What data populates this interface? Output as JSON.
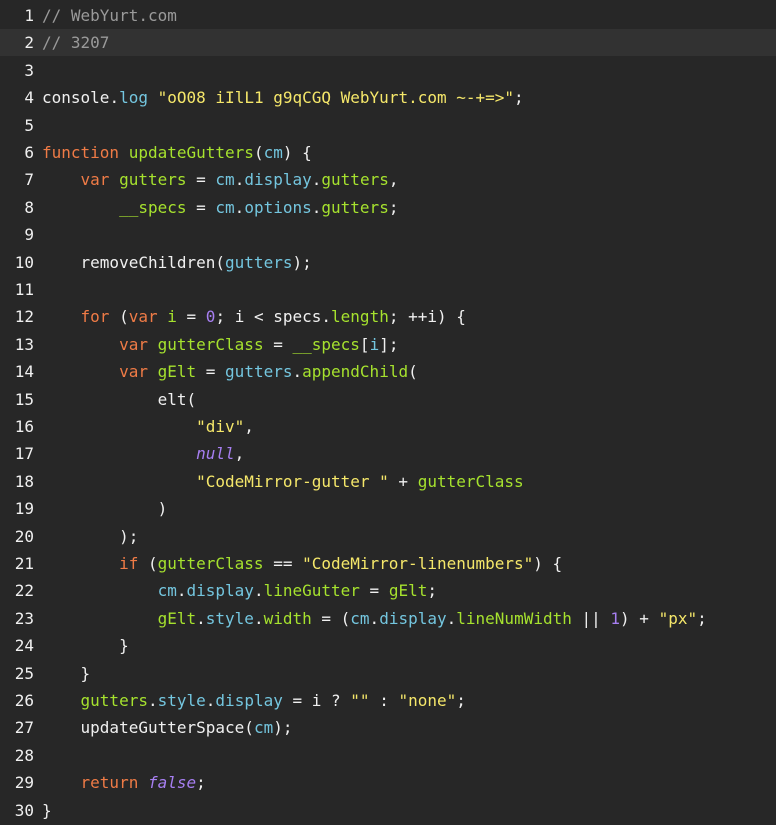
{
  "editor": {
    "active_line": 2,
    "colors": {
      "background": "#272727",
      "active_line": "#323232",
      "plain": "#f0f0f0",
      "comment": "#9a9a9a",
      "keyword": "#ef7b46",
      "atom": "#a77ff2",
      "number": "#a77ff2",
      "string": "#f5e76a",
      "variable": "#a6e22e",
      "property": "#74c6df",
      "def": "#f0f0f0",
      "operator": "#f0f0f0",
      "bracket": "#f0f0f0"
    },
    "lines": [
      {
        "n": "1",
        "indent": "",
        "tokens": [
          {
            "t": "// WebYurt.com",
            "c": "comment"
          }
        ]
      },
      {
        "n": "2",
        "indent": "",
        "tokens": [
          {
            "t": "// 3207",
            "c": "comment"
          }
        ]
      },
      {
        "n": "3",
        "indent": "",
        "tokens": []
      },
      {
        "n": "4",
        "indent": "",
        "tokens": [
          {
            "t": "console",
            "c": "plain"
          },
          {
            "t": ".",
            "c": "plain"
          },
          {
            "t": "log",
            "c": "property"
          },
          {
            "t": " ",
            "c": "plain"
          },
          {
            "t": "\"oO08 iIlL1 g9qCGQ WebYurt.com ~-+=>\"",
            "c": "string"
          },
          {
            "t": ";",
            "c": "plain"
          }
        ]
      },
      {
        "n": "5",
        "indent": "",
        "tokens": []
      },
      {
        "n": "6",
        "indent": "",
        "tokens": [
          {
            "t": "function",
            "c": "keyword"
          },
          {
            "t": " ",
            "c": "plain"
          },
          {
            "t": "updateGutters",
            "c": "variable"
          },
          {
            "t": "(",
            "c": "plain"
          },
          {
            "t": "cm",
            "c": "property"
          },
          {
            "t": ") {",
            "c": "plain"
          }
        ]
      },
      {
        "n": "7",
        "indent": "    ",
        "tokens": [
          {
            "t": "var",
            "c": "keyword"
          },
          {
            "t": " ",
            "c": "plain"
          },
          {
            "t": "gutters",
            "c": "variable"
          },
          {
            "t": " = ",
            "c": "plain"
          },
          {
            "t": "cm",
            "c": "property"
          },
          {
            "t": ".",
            "c": "plain"
          },
          {
            "t": "display",
            "c": "property"
          },
          {
            "t": ".",
            "c": "plain"
          },
          {
            "t": "gutters",
            "c": "variable"
          },
          {
            "t": ",",
            "c": "plain"
          }
        ]
      },
      {
        "n": "8",
        "indent": "        ",
        "tokens": [
          {
            "t": "__specs",
            "c": "variable"
          },
          {
            "t": " = ",
            "c": "plain"
          },
          {
            "t": "cm",
            "c": "property"
          },
          {
            "t": ".",
            "c": "plain"
          },
          {
            "t": "options",
            "c": "property"
          },
          {
            "t": ".",
            "c": "plain"
          },
          {
            "t": "gutters",
            "c": "variable"
          },
          {
            "t": ";",
            "c": "plain"
          }
        ]
      },
      {
        "n": "9",
        "indent": "",
        "tokens": []
      },
      {
        "n": "10",
        "indent": "    ",
        "tokens": [
          {
            "t": "removeChildren",
            "c": "plain"
          },
          {
            "t": "(",
            "c": "plain"
          },
          {
            "t": "gutters",
            "c": "property"
          },
          {
            "t": ");",
            "c": "plain"
          }
        ]
      },
      {
        "n": "11",
        "indent": "",
        "tokens": []
      },
      {
        "n": "12",
        "indent": "    ",
        "tokens": [
          {
            "t": "for",
            "c": "keyword"
          },
          {
            "t": " (",
            "c": "plain"
          },
          {
            "t": "var",
            "c": "keyword"
          },
          {
            "t": " ",
            "c": "plain"
          },
          {
            "t": "i",
            "c": "variable"
          },
          {
            "t": " = ",
            "c": "plain"
          },
          {
            "t": "0",
            "c": "number"
          },
          {
            "t": "; i < specs.",
            "c": "plain"
          },
          {
            "t": "length",
            "c": "variable"
          },
          {
            "t": "; ++i) {",
            "c": "plain"
          }
        ]
      },
      {
        "n": "13",
        "indent": "        ",
        "tokens": [
          {
            "t": "var",
            "c": "keyword"
          },
          {
            "t": " ",
            "c": "plain"
          },
          {
            "t": "gutterClass",
            "c": "variable"
          },
          {
            "t": " = ",
            "c": "plain"
          },
          {
            "t": "__specs",
            "c": "variable"
          },
          {
            "t": "[",
            "c": "plain"
          },
          {
            "t": "i",
            "c": "property"
          },
          {
            "t": "];",
            "c": "plain"
          }
        ]
      },
      {
        "n": "14",
        "indent": "        ",
        "tokens": [
          {
            "t": "var",
            "c": "keyword"
          },
          {
            "t": " ",
            "c": "plain"
          },
          {
            "t": "gElt",
            "c": "variable"
          },
          {
            "t": " = ",
            "c": "plain"
          },
          {
            "t": "gutters",
            "c": "property"
          },
          {
            "t": ".",
            "c": "plain"
          },
          {
            "t": "appendChild",
            "c": "variable"
          },
          {
            "t": "(",
            "c": "plain"
          }
        ]
      },
      {
        "n": "15",
        "indent": "            ",
        "tokens": [
          {
            "t": "elt(",
            "c": "plain"
          }
        ]
      },
      {
        "n": "16",
        "indent": "                ",
        "tokens": [
          {
            "t": "\"div\"",
            "c": "string"
          },
          {
            "t": ",",
            "c": "plain"
          }
        ]
      },
      {
        "n": "17",
        "indent": "                ",
        "tokens": [
          {
            "t": "null",
            "c": "atom"
          },
          {
            "t": ",",
            "c": "plain"
          }
        ]
      },
      {
        "n": "18",
        "indent": "                ",
        "tokens": [
          {
            "t": "\"CodeMirror-gutter \"",
            "c": "string"
          },
          {
            "t": " + ",
            "c": "plain"
          },
          {
            "t": "gutterClass",
            "c": "variable"
          }
        ]
      },
      {
        "n": "19",
        "indent": "            ",
        "tokens": [
          {
            "t": ")",
            "c": "plain"
          }
        ]
      },
      {
        "n": "20",
        "indent": "        ",
        "tokens": [
          {
            "t": ");",
            "c": "plain"
          }
        ]
      },
      {
        "n": "21",
        "indent": "        ",
        "tokens": [
          {
            "t": "if",
            "c": "keyword"
          },
          {
            "t": " (",
            "c": "plain"
          },
          {
            "t": "gutterClass",
            "c": "variable"
          },
          {
            "t": " == ",
            "c": "plain"
          },
          {
            "t": "\"CodeMirror-linenumbers\"",
            "c": "string"
          },
          {
            "t": ") {",
            "c": "plain"
          }
        ]
      },
      {
        "n": "22",
        "indent": "            ",
        "tokens": [
          {
            "t": "cm",
            "c": "property"
          },
          {
            "t": ".",
            "c": "plain"
          },
          {
            "t": "display",
            "c": "property"
          },
          {
            "t": ".",
            "c": "plain"
          },
          {
            "t": "lineGutter",
            "c": "variable"
          },
          {
            "t": " = ",
            "c": "plain"
          },
          {
            "t": "gElt",
            "c": "variable"
          },
          {
            "t": ";",
            "c": "plain"
          }
        ]
      },
      {
        "n": "23",
        "indent": "            ",
        "tokens": [
          {
            "t": "gElt",
            "c": "variable"
          },
          {
            "t": ".",
            "c": "plain"
          },
          {
            "t": "style",
            "c": "property"
          },
          {
            "t": ".",
            "c": "plain"
          },
          {
            "t": "width",
            "c": "variable"
          },
          {
            "t": " = (",
            "c": "plain"
          },
          {
            "t": "cm",
            "c": "property"
          },
          {
            "t": ".",
            "c": "plain"
          },
          {
            "t": "display",
            "c": "property"
          },
          {
            "t": ".",
            "c": "plain"
          },
          {
            "t": "lineNumWidth",
            "c": "variable"
          },
          {
            "t": " || ",
            "c": "plain"
          },
          {
            "t": "1",
            "c": "number"
          },
          {
            "t": ") + ",
            "c": "plain"
          },
          {
            "t": "\"px\"",
            "c": "string"
          },
          {
            "t": ";",
            "c": "plain"
          }
        ]
      },
      {
        "n": "24",
        "indent": "        ",
        "tokens": [
          {
            "t": "}",
            "c": "plain"
          }
        ]
      },
      {
        "n": "25",
        "indent": "    ",
        "tokens": [
          {
            "t": "}",
            "c": "plain"
          }
        ]
      },
      {
        "n": "26",
        "indent": "    ",
        "tokens": [
          {
            "t": "gutters",
            "c": "variable"
          },
          {
            "t": ".",
            "c": "plain"
          },
          {
            "t": "style",
            "c": "property"
          },
          {
            "t": ".",
            "c": "plain"
          },
          {
            "t": "display",
            "c": "property"
          },
          {
            "t": " = i ? ",
            "c": "plain"
          },
          {
            "t": "\"\"",
            "c": "string"
          },
          {
            "t": " : ",
            "c": "plain"
          },
          {
            "t": "\"none\"",
            "c": "string"
          },
          {
            "t": ";",
            "c": "plain"
          }
        ]
      },
      {
        "n": "27",
        "indent": "    ",
        "tokens": [
          {
            "t": "updateGutterSpace",
            "c": "plain"
          },
          {
            "t": "(",
            "c": "plain"
          },
          {
            "t": "cm",
            "c": "property"
          },
          {
            "t": ");",
            "c": "plain"
          }
        ]
      },
      {
        "n": "28",
        "indent": "",
        "tokens": []
      },
      {
        "n": "29",
        "indent": "    ",
        "tokens": [
          {
            "t": "return",
            "c": "keyword"
          },
          {
            "t": " ",
            "c": "plain"
          },
          {
            "t": "false",
            "c": "atom"
          },
          {
            "t": ";",
            "c": "plain"
          }
        ]
      },
      {
        "n": "30",
        "indent": "",
        "tokens": [
          {
            "t": "}",
            "c": "plain"
          }
        ]
      }
    ]
  }
}
